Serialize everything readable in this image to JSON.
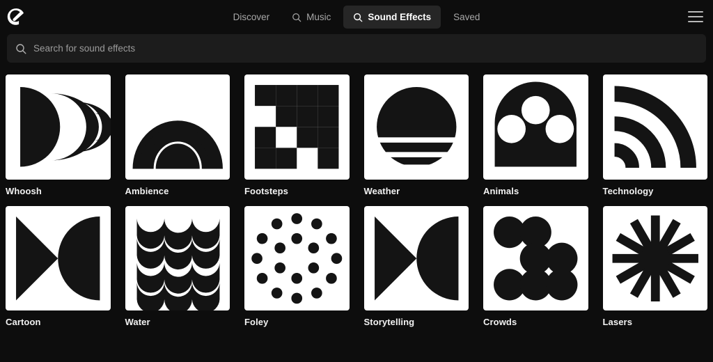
{
  "app": {
    "logo_icon": "epidemic-sound-logo-icon",
    "background_color": "#0d0d0d",
    "tile_background_color": "#ffffff",
    "tile_art_color": "#141414",
    "active_tab_color": "#262626"
  },
  "nav": {
    "menu_icon": "hamburger-menu-icon",
    "items": [
      {
        "label": "Discover",
        "icon": null,
        "active": false
      },
      {
        "label": "Music",
        "icon": "search-icon",
        "active": false
      },
      {
        "label": "Sound Effects",
        "icon": "search-icon",
        "active": true
      },
      {
        "label": "Saved",
        "icon": null,
        "active": false
      }
    ]
  },
  "search": {
    "icon": "search-icon",
    "placeholder": "Search for sound effects",
    "value": ""
  },
  "categories": [
    {
      "label": "Whoosh",
      "art": "whoosh"
    },
    {
      "label": "Ambience",
      "art": "ambience"
    },
    {
      "label": "Footsteps",
      "art": "footsteps"
    },
    {
      "label": "Weather",
      "art": "weather"
    },
    {
      "label": "Animals",
      "art": "animals"
    },
    {
      "label": "Technology",
      "art": "technology"
    },
    {
      "label": "Cartoon",
      "art": "cartoon"
    },
    {
      "label": "Water",
      "art": "water"
    },
    {
      "label": "Foley",
      "art": "foley"
    },
    {
      "label": "Storytelling",
      "art": "storytelling"
    },
    {
      "label": "Crowds",
      "art": "crowds"
    },
    {
      "label": "Lasers",
      "art": "lasers"
    }
  ]
}
